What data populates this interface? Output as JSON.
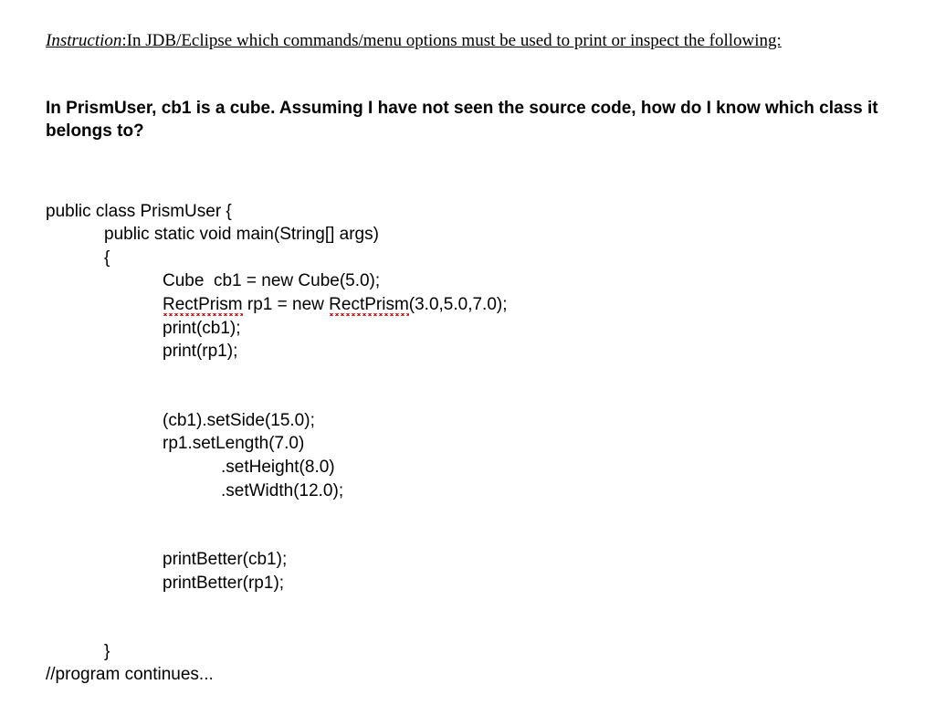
{
  "instruction": {
    "label": "Instruction",
    "text": ":In JDB/Eclipse which commands/menu options must be used to print or inspect the following:"
  },
  "question": "In PrismUser, cb1 is a cube. Assuming I have not seen the source code, how do I know which class it belongs to?",
  "code": {
    "l1": "public class PrismUser {",
    "l2": "public static void main(String[] args)",
    "l3": "{",
    "l4a": "Cube  cb1 = new Cube(5.0);",
    "l5a": "RectPrism",
    "l5b": " rp1 = new ",
    "l5c": "RectPrism",
    "l5d": "(3.0,5.0,7.0);",
    "l6": "print(cb1);",
    "l7": "print(rp1);",
    "l8": "(cb1).setSide(15.0);",
    "l9": "rp1.setLength(7.0)",
    "l10": ".setHeight(8.0)",
    "l11": ".setWidth(12.0);",
    "l12": "printBetter(cb1);",
    "l13": "printBetter(rp1);",
    "l14": "}",
    "l15": "//program continues..."
  }
}
